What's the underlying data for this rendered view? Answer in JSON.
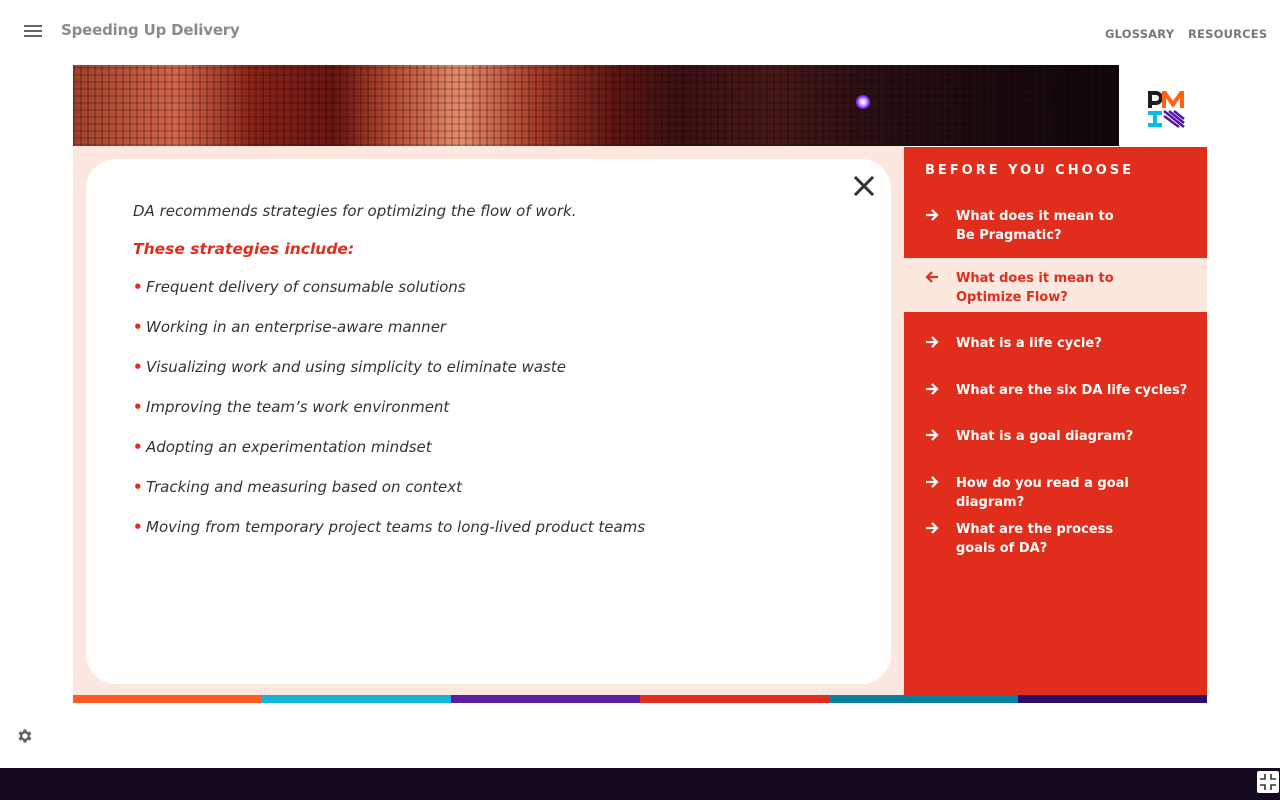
{
  "header": {
    "title": "Speeding Up Delivery",
    "menu_icon": "hamburger-menu-icon",
    "links": [
      "GLOSSARY",
      "RESOURCES"
    ]
  },
  "logo": {
    "name": "PMI logo",
    "colors": [
      "#ff610f",
      "#05bfe0",
      "#4f17a8",
      "#1e1e1e"
    ]
  },
  "content": {
    "intro": "DA recommends strategies for optimizing the flow of work.",
    "subheading": "These strategies include:",
    "strategies": [
      "Frequent delivery of consumable solutions",
      "Working in an enterprise-aware manner",
      "Visualizing work and using simplicity to eliminate waste",
      "Improving the team’s work environment",
      "Adopting an experimentation mindset",
      "Tracking and measuring based on context",
      "Moving from temporary project teams to long-lived product teams"
    ],
    "close_icon": "close-icon"
  },
  "sidebar": {
    "heading": "BEFORE YOU CHOOSE",
    "items": [
      {
        "line1": "What does it mean to",
        "line2": "Be Pragmatic?",
        "active": false,
        "icon": "arrow-right-icon"
      },
      {
        "line1": "What does it mean to",
        "line2": "Optimize Flow?",
        "active": true,
        "icon": "arrow-left-icon"
      },
      {
        "line1": "What is a life cycle?",
        "line2": "",
        "active": false,
        "icon": "arrow-right-icon"
      },
      {
        "line1": "What are the six DA life cycles?",
        "line2": "",
        "active": false,
        "icon": "arrow-right-icon"
      },
      {
        "line1": "What is a goal diagram?",
        "line2": "",
        "active": false,
        "icon": "arrow-right-icon"
      },
      {
        "line1": "How do you read a goal diagram?",
        "line2": "",
        "active": false,
        "icon": "arrow-right-icon"
      },
      {
        "line1": "What are the process",
        "line2": "goals of DA?",
        "active": false,
        "icon": "arrow-right-icon"
      }
    ]
  },
  "colors": {
    "accent": "#e02d1c",
    "accent_light": "#fde8df",
    "color_bar": [
      "#ff5a1f",
      "#12b5d9",
      "#5a1fa0",
      "#e02d1c",
      "#0a7f9e",
      "#2d0f6b"
    ],
    "bottom_bar": "#150a22"
  },
  "footer": {
    "settings_icon": "gear-icon",
    "fullscreen_icon": "exit-fullscreen-icon"
  }
}
